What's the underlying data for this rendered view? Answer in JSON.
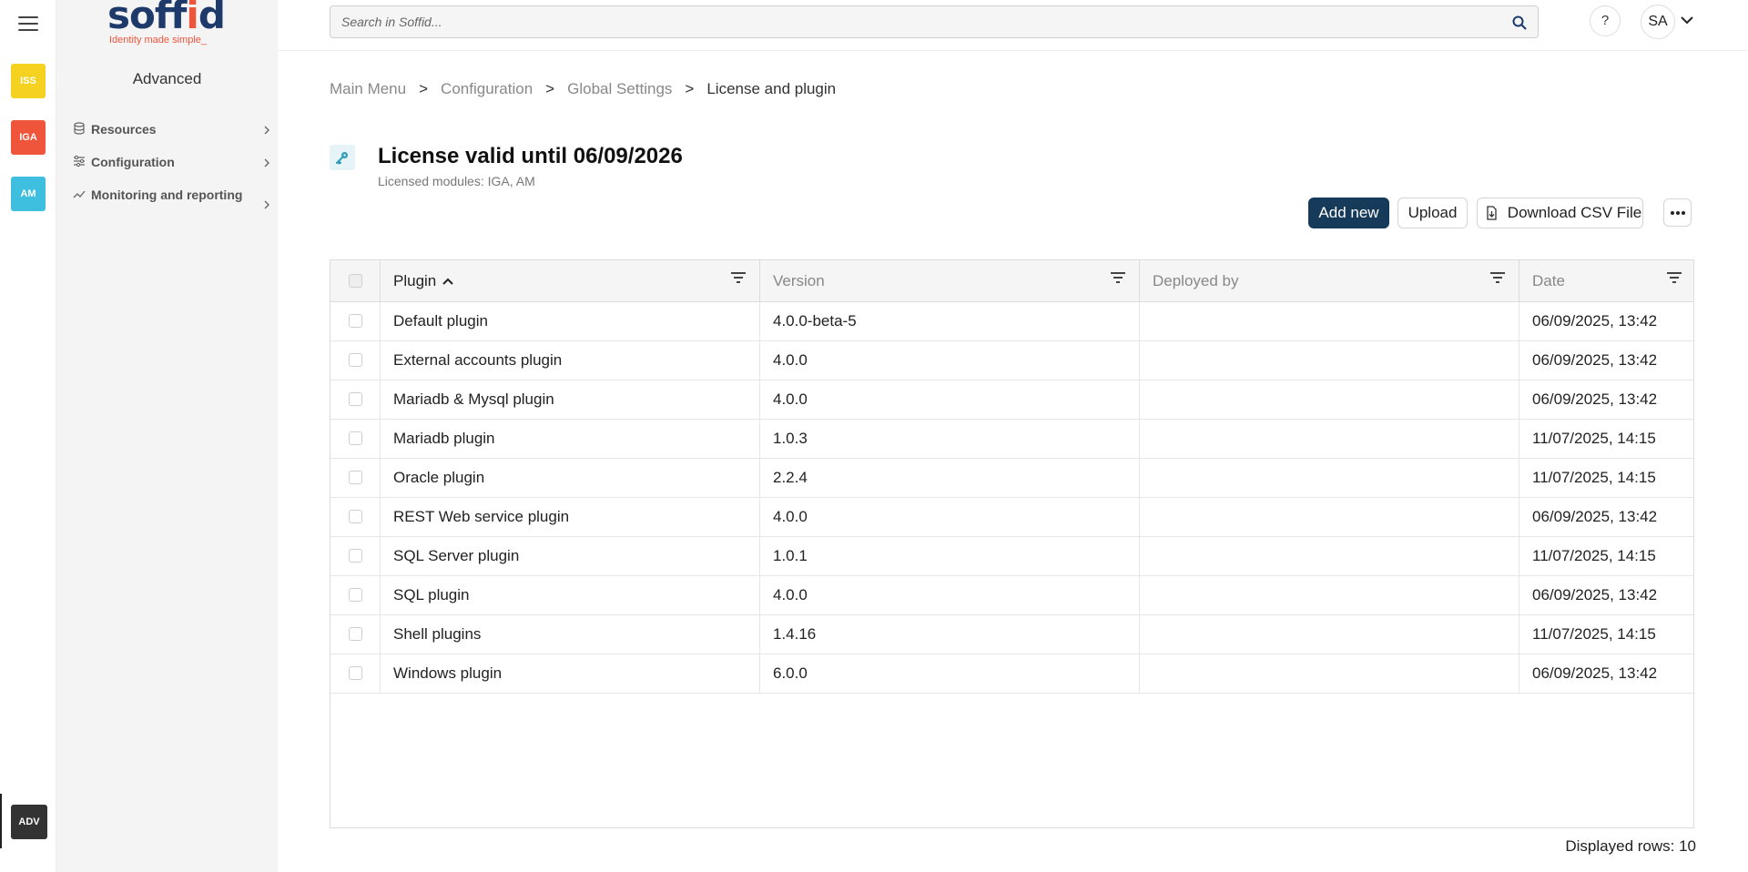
{
  "rail": {
    "apps": [
      {
        "label": "ISS",
        "color": "#f5d21f"
      },
      {
        "label": "IGA",
        "color": "#ef553a"
      },
      {
        "label": "AM",
        "color": "#3ebfdf"
      }
    ],
    "active_app": "ADV"
  },
  "logo": {
    "word_main": "soff",
    "word_accent": "i",
    "word_end": "d",
    "tagline": "Identity made simple_"
  },
  "sidemenu": {
    "title": "Advanced",
    "items": [
      {
        "label": "Resources",
        "icon": "database-icon"
      },
      {
        "label": "Configuration",
        "icon": "sliders-icon"
      },
      {
        "label": "Monitoring and reporting",
        "icon": "chart-line-icon"
      }
    ]
  },
  "topbar": {
    "search_placeholder": "Search in Soffid...",
    "help_label": "?",
    "user_initials": "SA"
  },
  "breadcrumb": {
    "items": [
      "Main Menu",
      "Configuration",
      "Global Settings",
      "License and plugin"
    ],
    "separator": ">"
  },
  "page": {
    "title": "License valid until 06/09/2026",
    "subtitle": "Licensed modules: IGA, AM",
    "title_icon": "key-icon"
  },
  "toolbar": {
    "add_label": "Add new",
    "upload_label": "Upload",
    "csv_label": "Download CSV File",
    "more_icon": "more-horizontal-icon"
  },
  "table": {
    "columns": [
      "Plugin",
      "Version",
      "Deployed by",
      "Date"
    ],
    "sorted_column": "Plugin",
    "rows": [
      {
        "plugin": "Default plugin",
        "version": "4.0.0-beta-5",
        "deployed_by": "",
        "date": "06/09/2025, 13:42"
      },
      {
        "plugin": "External accounts plugin",
        "version": "4.0.0",
        "deployed_by": "",
        "date": "06/09/2025, 13:42"
      },
      {
        "plugin": "Mariadb & Mysql plugin",
        "version": "4.0.0",
        "deployed_by": "",
        "date": "06/09/2025, 13:42"
      },
      {
        "plugin": "Mariadb plugin",
        "version": "1.0.3",
        "deployed_by": "",
        "date": "11/07/2025, 14:15"
      },
      {
        "plugin": "Oracle plugin",
        "version": "2.2.4",
        "deployed_by": "",
        "date": "11/07/2025, 14:15"
      },
      {
        "plugin": "REST Web service plugin",
        "version": "4.0.0",
        "deployed_by": "",
        "date": "06/09/2025, 13:42"
      },
      {
        "plugin": "SQL Server plugin",
        "version": "1.0.1",
        "deployed_by": "",
        "date": "11/07/2025, 14:15"
      },
      {
        "plugin": "SQL plugin",
        "version": "4.0.0",
        "deployed_by": "",
        "date": "06/09/2025, 13:42"
      },
      {
        "plugin": "Shell plugins",
        "version": "1.4.16",
        "deployed_by": "",
        "date": "11/07/2025, 14:15"
      },
      {
        "plugin": "Windows plugin",
        "version": "6.0.0",
        "deployed_by": "",
        "date": "06/09/2025, 13:42"
      }
    ],
    "footer": "Displayed rows: 10"
  }
}
